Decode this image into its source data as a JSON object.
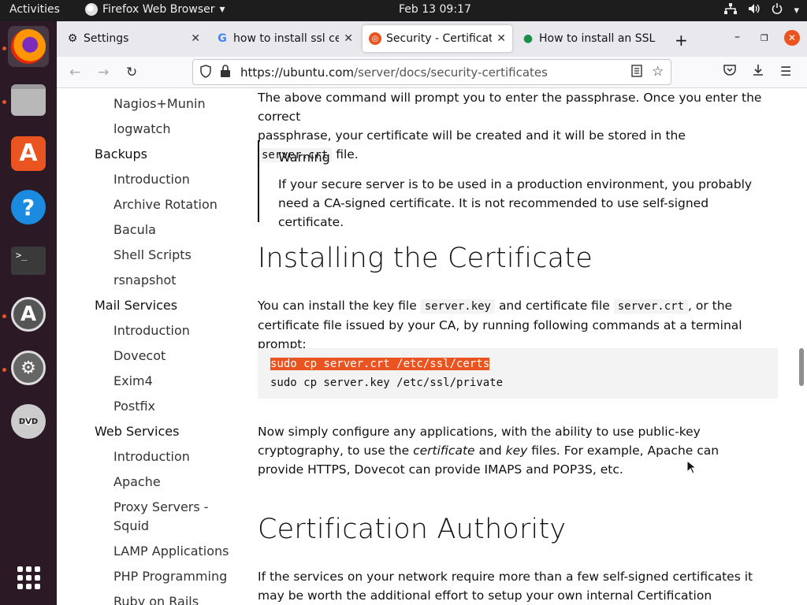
{
  "topbar": {
    "activities": "Activities",
    "app_menu": "Firefox Web Browser",
    "clock": "Feb 13  09:17"
  },
  "dock": {
    "apps": [
      "firefox-icon",
      "files-icon",
      "software-center-icon",
      "help-icon",
      "terminal-icon",
      "software-updater-icon",
      "settings-icon",
      "dvd-icon",
      "show-apps-icon"
    ]
  },
  "browser": {
    "tabs": [
      {
        "title": "Settings",
        "icon": "gear-icon"
      },
      {
        "title": "how to install ssl cer",
        "icon": "google-icon"
      },
      {
        "title": "Security - Certificate",
        "icon": "ubuntu-icon"
      },
      {
        "title": "How to install an SSL",
        "icon": "site-icon"
      }
    ],
    "url_domain": "https://ubuntu.com",
    "url_path": "/server/docs/security-certificates"
  },
  "sidebar": {
    "items": [
      {
        "label": "Nagios+Munin",
        "level": "sub"
      },
      {
        "label": "logwatch",
        "level": "sub"
      },
      {
        "label": "Backups",
        "level": "head"
      },
      {
        "label": "Introduction",
        "level": "sub"
      },
      {
        "label": "Archive Rotation",
        "level": "sub"
      },
      {
        "label": "Bacula",
        "level": "sub"
      },
      {
        "label": "Shell Scripts",
        "level": "sub"
      },
      {
        "label": "rsnapshot",
        "level": "sub"
      },
      {
        "label": "Mail Services",
        "level": "head"
      },
      {
        "label": "Introduction",
        "level": "sub"
      },
      {
        "label": "Dovecot",
        "level": "sub"
      },
      {
        "label": "Exim4",
        "level": "sub"
      },
      {
        "label": "Postfix",
        "level": "sub"
      },
      {
        "label": "Web Services",
        "level": "head"
      },
      {
        "label": "Introduction",
        "level": "sub"
      },
      {
        "label": "Apache",
        "level": "sub"
      },
      {
        "label": "Proxy Servers -",
        "level": "sub"
      },
      {
        "label": "Squid",
        "level": "sub"
      },
      {
        "label": "LAMP Applications",
        "level": "sub"
      },
      {
        "label": "PHP Programming",
        "level": "sub"
      },
      {
        "label": "Ruby on Rails",
        "level": "sub"
      }
    ]
  },
  "content": {
    "intro_line1": "The above command will prompt you to enter the passphrase. Once you enter the correct",
    "intro_line2a": "passphrase, your certificate will be created and it will be stored in the",
    "intro_code": "server.crt",
    "intro_line2b": "file.",
    "warning_title": "Warning",
    "warning_body": "If your secure server is to be used in a production environment, you probably need a CA-signed certificate. It is not recommended to use self-signed certificate.",
    "h_install": "Installing the Certificate",
    "install_a": "You can install the key file",
    "install_code1": "server.key",
    "install_b": "and certificate file",
    "install_code2": "server.crt",
    "install_c": ", or the certificate file issued by your CA, by running following commands at a terminal prompt:",
    "code_line1": "sudo cp server.crt /etc/ssl/certs",
    "code_line2": "sudo cp server.key /etc/ssl/private",
    "config_a": "Now simply configure any applications, with the ability to use public-key cryptography, to use the",
    "config_em1": "certificate",
    "config_b": "and",
    "config_em2": "key",
    "config_c": "files. For example, Apache can provide HTTPS, Dovecot can provide IMAPS and POP3S, etc.",
    "h_ca": "Certification Authority",
    "ca_text": "If the services on your network require more than a few self-signed certificates it may be worth the additional effort to setup your own internal Certification Authority (CA). Using"
  }
}
